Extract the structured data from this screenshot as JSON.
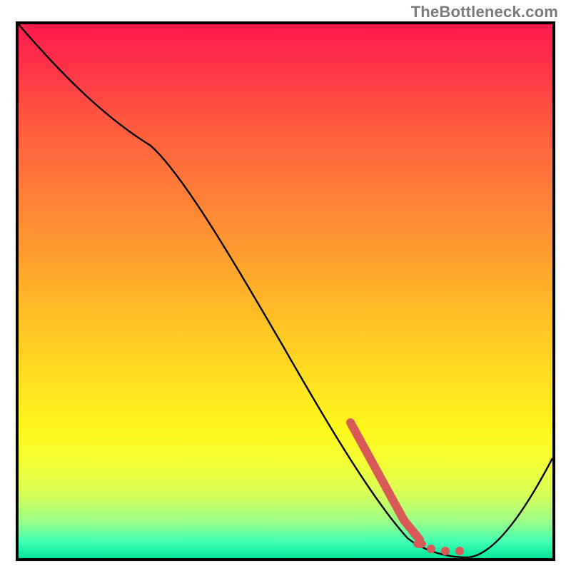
{
  "attribution": "TheBottleneck.com",
  "chart_data": {
    "type": "line",
    "title": "",
    "xlabel": "",
    "ylabel": "",
    "xlim": [
      0,
      100
    ],
    "ylim": [
      0,
      100
    ],
    "series": [
      {
        "name": "bottleneck-curve",
        "x": [
          0,
          12,
          25,
          38,
          50,
          62,
          70,
          76,
          80,
          84,
          92,
          100
        ],
        "y": [
          100,
          88,
          78,
          60,
          42,
          24,
          12,
          4,
          1,
          0,
          10,
          24
        ],
        "note": "y is percent height from bottom; curve descends, bottoms near x≈83, then rises"
      },
      {
        "name": "highlight-segment",
        "x": [
          62,
          66,
          70,
          73,
          76,
          78,
          80,
          82
        ],
        "y": [
          24,
          17,
          11,
          7,
          4,
          2,
          1,
          0.5
        ],
        "style": "thick-dashed-red"
      }
    ],
    "background": "vertical-gradient-red-to-green"
  }
}
